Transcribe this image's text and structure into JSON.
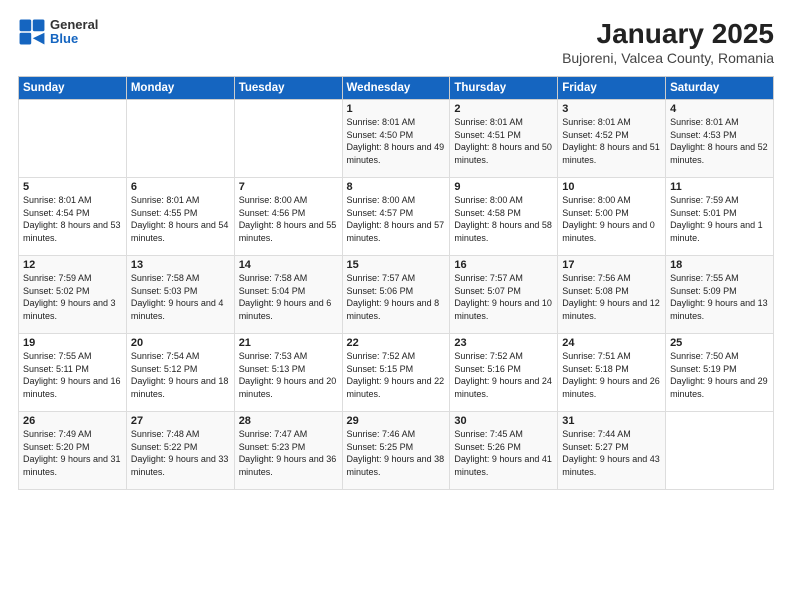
{
  "logo": {
    "general": "General",
    "blue": "Blue"
  },
  "title": "January 2025",
  "subtitle": "Bujoreni, Valcea County, Romania",
  "headers": [
    "Sunday",
    "Monday",
    "Tuesday",
    "Wednesday",
    "Thursday",
    "Friday",
    "Saturday"
  ],
  "weeks": [
    [
      {
        "day": "",
        "sunrise": "",
        "sunset": "",
        "daylight": ""
      },
      {
        "day": "",
        "sunrise": "",
        "sunset": "",
        "daylight": ""
      },
      {
        "day": "",
        "sunrise": "",
        "sunset": "",
        "daylight": ""
      },
      {
        "day": "1",
        "sunrise": "Sunrise: 8:01 AM",
        "sunset": "Sunset: 4:50 PM",
        "daylight": "Daylight: 8 hours and 49 minutes."
      },
      {
        "day": "2",
        "sunrise": "Sunrise: 8:01 AM",
        "sunset": "Sunset: 4:51 PM",
        "daylight": "Daylight: 8 hours and 50 minutes."
      },
      {
        "day": "3",
        "sunrise": "Sunrise: 8:01 AM",
        "sunset": "Sunset: 4:52 PM",
        "daylight": "Daylight: 8 hours and 51 minutes."
      },
      {
        "day": "4",
        "sunrise": "Sunrise: 8:01 AM",
        "sunset": "Sunset: 4:53 PM",
        "daylight": "Daylight: 8 hours and 52 minutes."
      }
    ],
    [
      {
        "day": "5",
        "sunrise": "Sunrise: 8:01 AM",
        "sunset": "Sunset: 4:54 PM",
        "daylight": "Daylight: 8 hours and 53 minutes."
      },
      {
        "day": "6",
        "sunrise": "Sunrise: 8:01 AM",
        "sunset": "Sunset: 4:55 PM",
        "daylight": "Daylight: 8 hours and 54 minutes."
      },
      {
        "day": "7",
        "sunrise": "Sunrise: 8:00 AM",
        "sunset": "Sunset: 4:56 PM",
        "daylight": "Daylight: 8 hours and 55 minutes."
      },
      {
        "day": "8",
        "sunrise": "Sunrise: 8:00 AM",
        "sunset": "Sunset: 4:57 PM",
        "daylight": "Daylight: 8 hours and 57 minutes."
      },
      {
        "day": "9",
        "sunrise": "Sunrise: 8:00 AM",
        "sunset": "Sunset: 4:58 PM",
        "daylight": "Daylight: 8 hours and 58 minutes."
      },
      {
        "day": "10",
        "sunrise": "Sunrise: 8:00 AM",
        "sunset": "Sunset: 5:00 PM",
        "daylight": "Daylight: 9 hours and 0 minutes."
      },
      {
        "day": "11",
        "sunrise": "Sunrise: 7:59 AM",
        "sunset": "Sunset: 5:01 PM",
        "daylight": "Daylight: 9 hours and 1 minute."
      }
    ],
    [
      {
        "day": "12",
        "sunrise": "Sunrise: 7:59 AM",
        "sunset": "Sunset: 5:02 PM",
        "daylight": "Daylight: 9 hours and 3 minutes."
      },
      {
        "day": "13",
        "sunrise": "Sunrise: 7:58 AM",
        "sunset": "Sunset: 5:03 PM",
        "daylight": "Daylight: 9 hours and 4 minutes."
      },
      {
        "day": "14",
        "sunrise": "Sunrise: 7:58 AM",
        "sunset": "Sunset: 5:04 PM",
        "daylight": "Daylight: 9 hours and 6 minutes."
      },
      {
        "day": "15",
        "sunrise": "Sunrise: 7:57 AM",
        "sunset": "Sunset: 5:06 PM",
        "daylight": "Daylight: 9 hours and 8 minutes."
      },
      {
        "day": "16",
        "sunrise": "Sunrise: 7:57 AM",
        "sunset": "Sunset: 5:07 PM",
        "daylight": "Daylight: 9 hours and 10 minutes."
      },
      {
        "day": "17",
        "sunrise": "Sunrise: 7:56 AM",
        "sunset": "Sunset: 5:08 PM",
        "daylight": "Daylight: 9 hours and 12 minutes."
      },
      {
        "day": "18",
        "sunrise": "Sunrise: 7:55 AM",
        "sunset": "Sunset: 5:09 PM",
        "daylight": "Daylight: 9 hours and 13 minutes."
      }
    ],
    [
      {
        "day": "19",
        "sunrise": "Sunrise: 7:55 AM",
        "sunset": "Sunset: 5:11 PM",
        "daylight": "Daylight: 9 hours and 16 minutes."
      },
      {
        "day": "20",
        "sunrise": "Sunrise: 7:54 AM",
        "sunset": "Sunset: 5:12 PM",
        "daylight": "Daylight: 9 hours and 18 minutes."
      },
      {
        "day": "21",
        "sunrise": "Sunrise: 7:53 AM",
        "sunset": "Sunset: 5:13 PM",
        "daylight": "Daylight: 9 hours and 20 minutes."
      },
      {
        "day": "22",
        "sunrise": "Sunrise: 7:52 AM",
        "sunset": "Sunset: 5:15 PM",
        "daylight": "Daylight: 9 hours and 22 minutes."
      },
      {
        "day": "23",
        "sunrise": "Sunrise: 7:52 AM",
        "sunset": "Sunset: 5:16 PM",
        "daylight": "Daylight: 9 hours and 24 minutes."
      },
      {
        "day": "24",
        "sunrise": "Sunrise: 7:51 AM",
        "sunset": "Sunset: 5:18 PM",
        "daylight": "Daylight: 9 hours and 26 minutes."
      },
      {
        "day": "25",
        "sunrise": "Sunrise: 7:50 AM",
        "sunset": "Sunset: 5:19 PM",
        "daylight": "Daylight: 9 hours and 29 minutes."
      }
    ],
    [
      {
        "day": "26",
        "sunrise": "Sunrise: 7:49 AM",
        "sunset": "Sunset: 5:20 PM",
        "daylight": "Daylight: 9 hours and 31 minutes."
      },
      {
        "day": "27",
        "sunrise": "Sunrise: 7:48 AM",
        "sunset": "Sunset: 5:22 PM",
        "daylight": "Daylight: 9 hours and 33 minutes."
      },
      {
        "day": "28",
        "sunrise": "Sunrise: 7:47 AM",
        "sunset": "Sunset: 5:23 PM",
        "daylight": "Daylight: 9 hours and 36 minutes."
      },
      {
        "day": "29",
        "sunrise": "Sunrise: 7:46 AM",
        "sunset": "Sunset: 5:25 PM",
        "daylight": "Daylight: 9 hours and 38 minutes."
      },
      {
        "day": "30",
        "sunrise": "Sunrise: 7:45 AM",
        "sunset": "Sunset: 5:26 PM",
        "daylight": "Daylight: 9 hours and 41 minutes."
      },
      {
        "day": "31",
        "sunrise": "Sunrise: 7:44 AM",
        "sunset": "Sunset: 5:27 PM",
        "daylight": "Daylight: 9 hours and 43 minutes."
      },
      {
        "day": "",
        "sunrise": "",
        "sunset": "",
        "daylight": ""
      }
    ]
  ]
}
